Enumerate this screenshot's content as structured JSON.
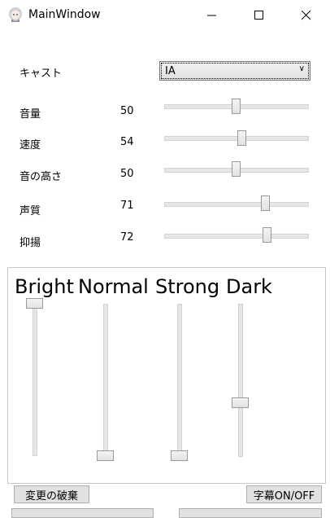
{
  "window": {
    "title": "MainWindow"
  },
  "cast": {
    "label": "キャスト",
    "selected": "IA"
  },
  "params": [
    {
      "label": "音量",
      "value": 50,
      "slider_fraction": 0.5
    },
    {
      "label": "速度",
      "value": 54,
      "slider_fraction": 0.54
    },
    {
      "label": "音の高さ",
      "value": 50,
      "slider_fraction": 0.5
    },
    {
      "label": "声質",
      "value": 71,
      "slider_fraction": 0.71
    },
    {
      "label": "抑揚",
      "value": 72,
      "slider_fraction": 0.72
    }
  ],
  "emotions": [
    {
      "label": "Bright",
      "level_fraction": 1.0
    },
    {
      "label": "Normal",
      "level_fraction": 0.0
    },
    {
      "label": "Strong",
      "level_fraction": 0.0
    },
    {
      "label": "Dark",
      "level_fraction": 0.35
    }
  ],
  "buttons": {
    "discard_label": "変更の破棄",
    "subtitle_label": "字幕ON/OFF"
  }
}
